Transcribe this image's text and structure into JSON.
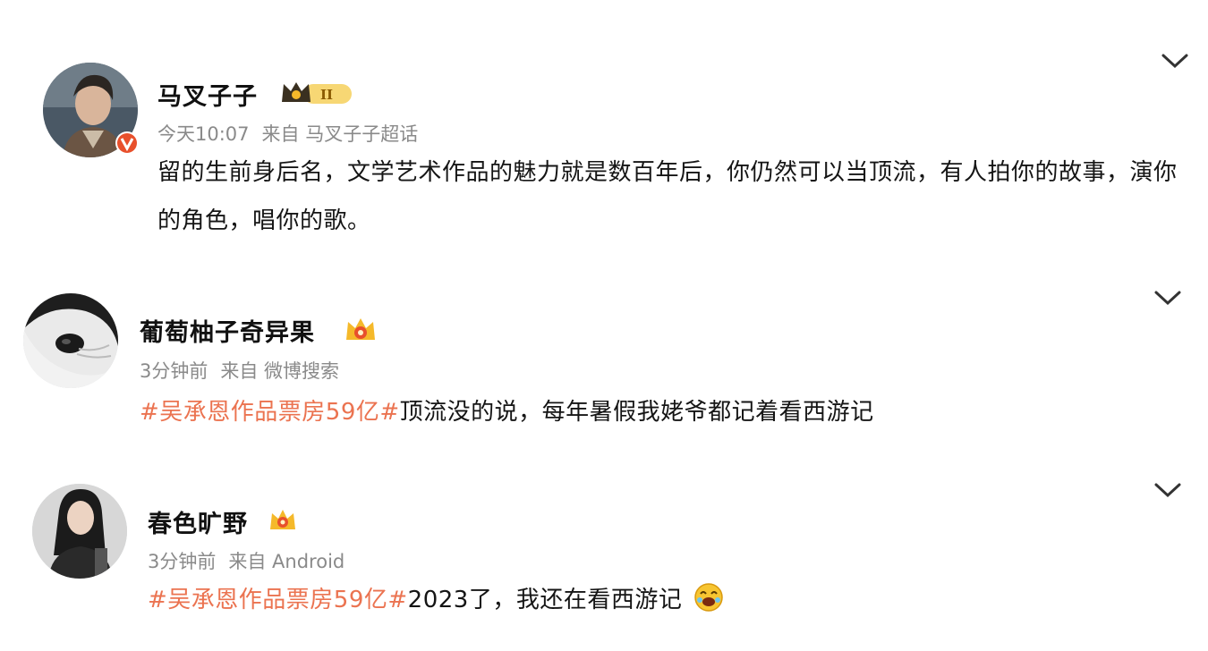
{
  "posts": [
    {
      "author": "马叉子子",
      "time": "今天10:07",
      "from": "来自 马叉子子超话",
      "text": "留的生前身后名，文学艺术作品的魅力就是数百年后，你仍然可以当顶流，有人拍你的故事，演你的角色，唱你的歌。",
      "badge_text": "II"
    },
    {
      "author": "葡萄柚子奇异果",
      "time": "3分钟前",
      "from": "来自 微博搜索",
      "hashtag": "#吴承恩作品票房59亿#",
      "text": "顶流没的说，每年暑假我姥爷都记着看西游记"
    },
    {
      "author": "春色旷野",
      "time": "3分钟前",
      "from": "来自 Android",
      "hashtag": "#吴承恩作品票房59亿#",
      "text": "2023了，我还在看西游记"
    }
  ],
  "colors": {
    "hashtag": "#eb7350",
    "meta": "#8a8a8a",
    "badge_gold": "#f5b92a",
    "verified": "#e8502c"
  },
  "icons": [
    "chevron-down-icon",
    "crown-badge-icon",
    "verified-badge-icon",
    "laugh-emoji-icon"
  ]
}
